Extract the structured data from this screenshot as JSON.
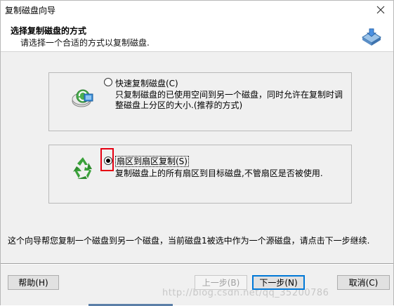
{
  "window": {
    "title": "复制磁盘向导"
  },
  "header": {
    "title": "选择复制磁盘的方式",
    "subtitle": "请选择一个合适的方式以复制磁盘."
  },
  "options": [
    {
      "label": "快速复制磁盘(C)",
      "description": "只复制磁盘的已使用空间到另一个磁盘，同时允许在复制时调整磁盘上分区的大小.(推荐的方式)",
      "selected": false
    },
    {
      "label": "扇区到扇区复制(S)",
      "description": "复制磁盘上的所有扇区到目标磁盘,不管扇区是否被使用.",
      "selected": true
    }
  ],
  "info_text": "这个向导帮您复制一个磁盘到另一个磁盘，当前磁盘1被选中作为一个源磁盘，请点击下一步继续.",
  "buttons": {
    "help": "帮助(H)",
    "back": "上一步(B)",
    "next": "下一步(N)",
    "cancel": "取消(C)"
  },
  "watermark": "http://blog.csdn.net/qq_35200786",
  "colors": {
    "highlight": "#e60012",
    "panel": "#f0f0f0",
    "default_button": "#0078d7"
  }
}
